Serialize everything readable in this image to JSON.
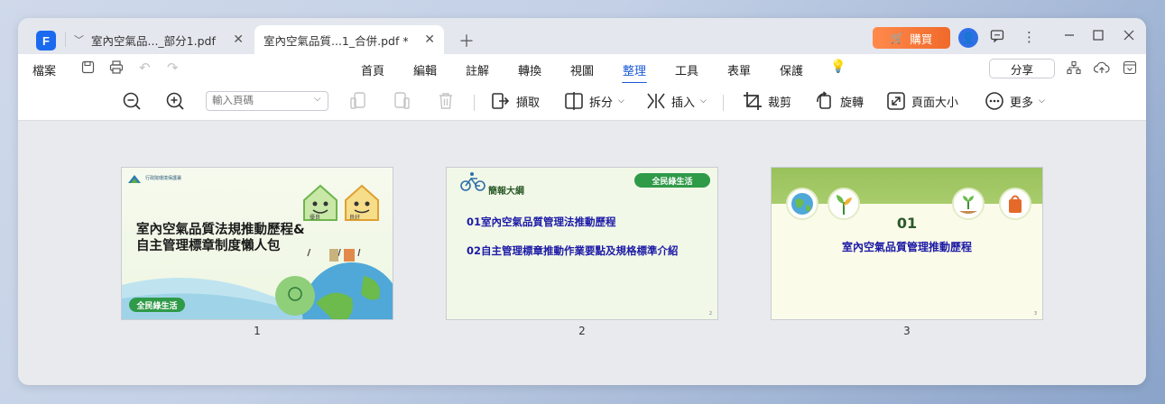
{
  "tabs": [
    {
      "label": "室內空氣品..._部分1.pdf"
    },
    {
      "label": "室內空氣品質...1_合併.pdf *"
    }
  ],
  "header": {
    "buy_label": "購買"
  },
  "menu": {
    "file_label": "檔案",
    "items": [
      "首頁",
      "編輯",
      "註解",
      "轉換",
      "視圖",
      "整理",
      "工具",
      "表單",
      "保護"
    ],
    "active_index": 5,
    "share_label": "分享"
  },
  "toolbar": {
    "page_input_placeholder": "輸入頁碼",
    "extract_label": "擷取",
    "split_label": "拆分",
    "insert_label": "插入",
    "crop_label": "裁剪",
    "rotate_label": "旋轉",
    "page_size_label": "頁面大小",
    "more_label": "更多"
  },
  "pages": [
    {
      "number": "1",
      "title_line1": "室內空氣品質法規推動歷程&",
      "title_line2": "自主管理標章制度懶人包",
      "org": "行政院環境保護署",
      "label_a": "優良",
      "label_b": "良好",
      "badge": "全民綠生活"
    },
    {
      "number": "2",
      "heading": "簡報大綱",
      "line1": "01室內空氣品質管理法推動歷程",
      "line2": "02自主管理標章推動作業要點及規格標準介紹",
      "badge": "全民綠生活",
      "page_no": "2"
    },
    {
      "number": "3",
      "section_num": "01",
      "section_title": "室內空氣品質管理推動歷程",
      "page_no": "3"
    }
  ],
  "colors": {
    "accent": "#1a5bd6",
    "buy": "#f06a2a",
    "green_badge": "#2f9a48",
    "slide_text_blue": "#1c1aa6"
  }
}
